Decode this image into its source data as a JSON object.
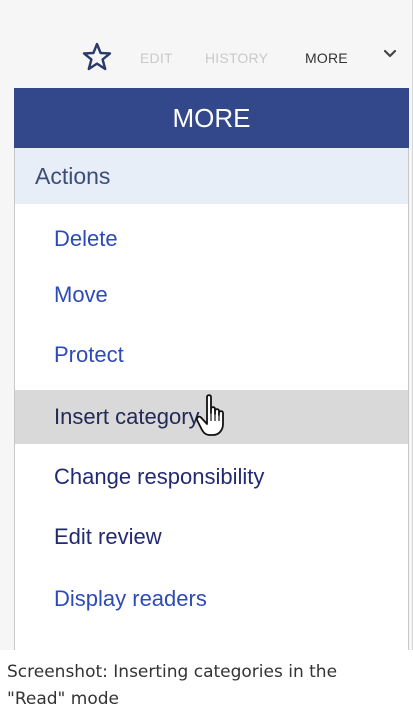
{
  "toolbar": {
    "star_icon": "star-icon",
    "edit_label": "EDIT",
    "history_label": "HISTORY",
    "more_label": "MORE",
    "chevron_icon": "chevron-down-icon"
  },
  "menu": {
    "title": "MORE",
    "section_label": "Actions",
    "items": [
      {
        "label": "Delete"
      },
      {
        "label": "Move"
      },
      {
        "label": "Protect"
      },
      {
        "label": "Insert category"
      },
      {
        "label": "Change responsibility"
      },
      {
        "label": "Edit review"
      },
      {
        "label": "Display readers"
      }
    ],
    "hovered_item": "Insert category"
  },
  "caption": {
    "text": "Screenshot: Inserting categories in the \"Read\" mode"
  },
  "colors": {
    "header_bg": "#33488a",
    "section_bg": "#e7eef8",
    "link": "#2d4bb8",
    "hover_bg": "#d9d9d9"
  }
}
